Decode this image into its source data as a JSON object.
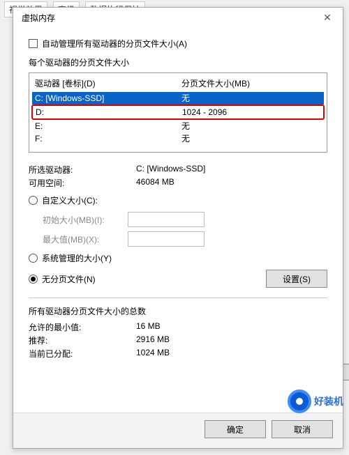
{
  "bg_tabs": {
    "t1": "视觉效果",
    "t2": "高级",
    "t3": "数据执行保护"
  },
  "title": "虚拟内存",
  "auto_manage": "自动管理所有驱动器的分页文件大小(A)",
  "per_drive_label": "每个驱动器的分页文件大小",
  "headers": {
    "drive": "驱动器 [卷标](D)",
    "size": "分页文件大小(MB)"
  },
  "drives": [
    {
      "name": "C:      [Windows-SSD]",
      "size": "无"
    },
    {
      "name": "D:",
      "size": "1024 - 2096"
    },
    {
      "name": "E:",
      "size": "无"
    },
    {
      "name": "F:",
      "size": "无"
    }
  ],
  "selected_label": "所选驱动器:",
  "selected_value": "C:  [Windows-SSD]",
  "avail_label": "可用空间:",
  "avail_value": "46084 MB",
  "radio_custom": "自定义大小(C):",
  "initial_label": "初始大小(MB)(I):",
  "max_label": "最大值(MB)(X):",
  "radio_sys": "系统管理的大小(Y)",
  "radio_none": "无分页文件(N)",
  "set_btn": "设置(S)",
  "totals_label": "所有驱动器分页文件大小的总数",
  "min_label": "允许的最小值:",
  "min_value": "16 MB",
  "rec_label": "推荐:",
  "rec_value": "2916 MB",
  "cur_label": "当前已分配:",
  "cur_value": "1024 MB",
  "ok": "确定",
  "cancel": "取消",
  "watermark": "好装机",
  "bg_set": "置"
}
